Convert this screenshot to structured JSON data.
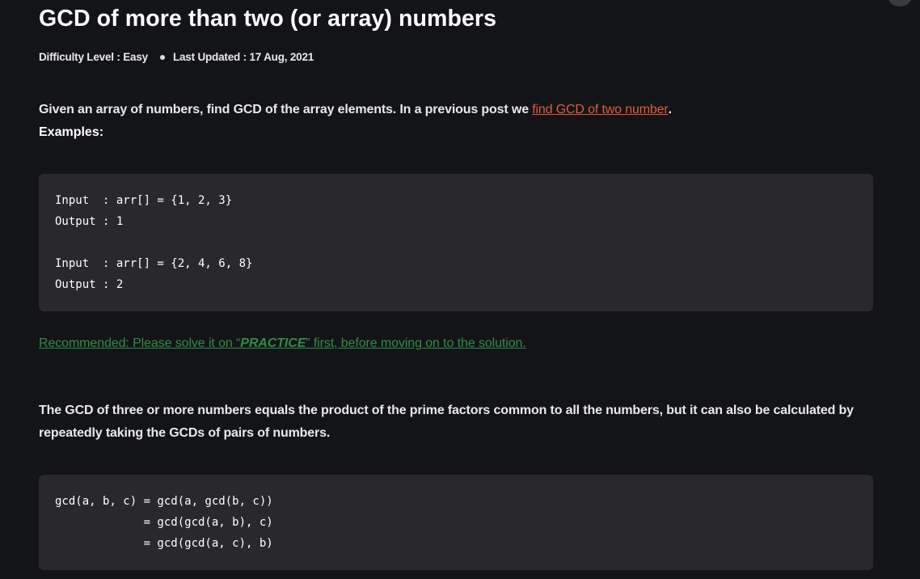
{
  "article": {
    "title": "GCD of more than two (or array) numbers",
    "meta": {
      "difficulty": "Difficulty Level : Easy",
      "last_updated": "Last Updated : 17 Aug, 2021"
    },
    "intro": {
      "text": "Given an array of numbers, find GCD of the array elements. In a previous post we ",
      "link": "find GCD of two number",
      "end": "."
    },
    "examples_label": "Examples:",
    "example_code": [
      "Input  : arr[] = {1, 2, 3}",
      "Output : 1",
      "Input  : arr[] = {2, 4, 6, 8}",
      "Output : 2"
    ],
    "recommended": {
      "prefix": "Recommended: Please solve it on “",
      "practice": "PRACTICE",
      "suffix": "” first, before moving on to the solution."
    },
    "body_text": "The GCD of three or more numbers equals the product of the prime factors common to all the numbers, but it can also be calculated by repeatedly taking the GCDs of pairs of numbers.",
    "formula_code": [
      "gcd(a, b, c) = gcd(a, gcd(b, c))",
      "             = gcd(gcd(a, b), c)",
      "             = gcd(gcd(a, c), b)"
    ]
  },
  "colors": {
    "background": "#131417",
    "code_background": "#29292c",
    "link": "#e25b3b",
    "practice_link": "#2f8d46"
  }
}
